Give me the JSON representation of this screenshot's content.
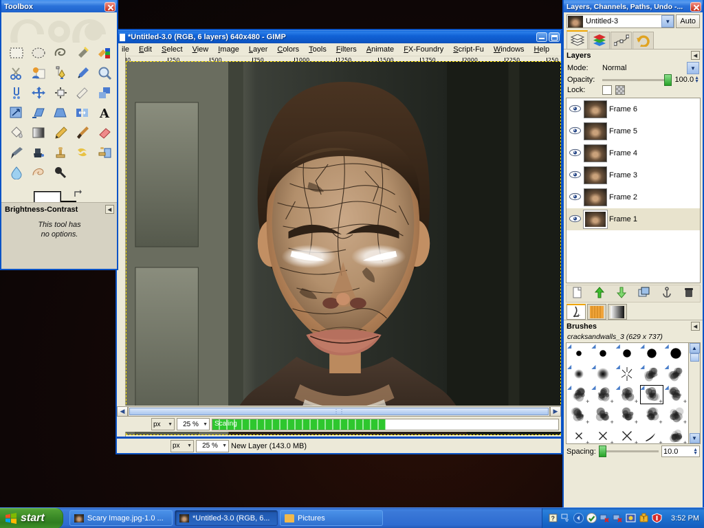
{
  "toolbox": {
    "title": "Toolbox",
    "tools": [
      {
        "name": "rect-select-tool",
        "label": "Rectangle Select"
      },
      {
        "name": "ellipse-select-tool",
        "label": "Ellipse Select"
      },
      {
        "name": "free-select-tool",
        "label": "Free Select"
      },
      {
        "name": "fuzzy-select-tool",
        "label": "Fuzzy Select"
      },
      {
        "name": "select-by-color-tool",
        "label": "Select by Color"
      },
      {
        "name": "scissors-select-tool",
        "label": "Intelligent Scissors"
      },
      {
        "name": "foreground-select-tool",
        "label": "Foreground Select"
      },
      {
        "name": "paths-tool",
        "label": "Paths"
      },
      {
        "name": "color-picker-tool",
        "label": "Color Picker"
      },
      {
        "name": "zoom-tool",
        "label": "Zoom"
      },
      {
        "name": "measure-tool",
        "label": "Measure"
      },
      {
        "name": "move-tool",
        "label": "Move"
      },
      {
        "name": "align-tool",
        "label": "Alignment"
      },
      {
        "name": "crop-tool",
        "label": "Crop"
      },
      {
        "name": "rotate-tool",
        "label": "Rotate"
      },
      {
        "name": "scale-tool",
        "label": "Scale"
      },
      {
        "name": "shear-tool",
        "label": "Shear"
      },
      {
        "name": "perspective-tool",
        "label": "Perspective"
      },
      {
        "name": "flip-tool",
        "label": "Flip"
      },
      {
        "name": "text-tool",
        "label": "Text"
      },
      {
        "name": "bucket-fill-tool",
        "label": "Bucket Fill"
      },
      {
        "name": "blend-tool",
        "label": "Blend"
      },
      {
        "name": "pencil-tool",
        "label": "Pencil"
      },
      {
        "name": "paintbrush-tool",
        "label": "Paintbrush"
      },
      {
        "name": "eraser-tool",
        "label": "Eraser"
      },
      {
        "name": "airbrush-tool",
        "label": "Airbrush"
      },
      {
        "name": "ink-tool",
        "label": "Ink"
      },
      {
        "name": "clone-tool",
        "label": "Clone"
      },
      {
        "name": "heal-tool",
        "label": "Heal"
      },
      {
        "name": "perspective-clone-tool",
        "label": "Perspective Clone"
      },
      {
        "name": "blur-sharpen-tool",
        "label": "Blur / Sharpen"
      },
      {
        "name": "smudge-tool",
        "label": "Smudge"
      },
      {
        "name": "dodge-burn-tool",
        "label": "Dodge / Burn"
      }
    ],
    "colors": {
      "foreground": "#ffffff",
      "background": "#000000"
    },
    "options": {
      "title": "Brightness-Contrast",
      "body_line1": "This tool has",
      "body_line2": "no options."
    }
  },
  "image_window": {
    "title": "*Untitled-3.0 (RGB, 6 layers) 640x480 - GIMP",
    "menu": [
      "ile",
      "Edit",
      "Select",
      "View",
      "Image",
      "Layer",
      "Colors",
      "Tools",
      "Filters",
      "Animate",
      "FX-Foundry",
      "Script-Fu",
      "Windows",
      "Help"
    ],
    "ruler_labels": [
      "0",
      "250",
      "500",
      "750",
      "1000",
      "1250",
      "1500",
      "1750",
      "2000",
      "2250",
      "250"
    ],
    "statusbar": {
      "unit": "px",
      "zoom": "25 %",
      "progress_label": "Scaling",
      "progress_percent": 50
    },
    "statusbar2": {
      "unit": "px",
      "zoom": "25 %",
      "message": "New Layer (143.0 MB)"
    },
    "buttons": {
      "minimize": "minimize",
      "maximize": "maximize"
    }
  },
  "dock": {
    "title": "Layers, Channels, Paths, Undo -...",
    "image_selector": {
      "value": "Untitled-3",
      "auto_label": "Auto"
    },
    "tabs": [
      {
        "name": "tab-layers",
        "label": "Layers",
        "active": true
      },
      {
        "name": "tab-channels",
        "label": "Channels",
        "active": false
      },
      {
        "name": "tab-paths",
        "label": "Paths",
        "active": false
      },
      {
        "name": "tab-undo",
        "label": "Undo History",
        "active": false
      }
    ],
    "layers_panel": {
      "title": "Layers",
      "mode_label": "Mode:",
      "mode_value": "Normal",
      "opacity_label": "Opacity:",
      "opacity_value": "100.0",
      "lock_label": "Lock:",
      "layers": [
        {
          "name": "Frame 6",
          "visible": true,
          "selected": false
        },
        {
          "name": "Frame 5",
          "visible": true,
          "selected": false
        },
        {
          "name": "Frame 4",
          "visible": true,
          "selected": false
        },
        {
          "name": "Frame 3",
          "visible": true,
          "selected": false
        },
        {
          "name": "Frame 2",
          "visible": true,
          "selected": false
        },
        {
          "name": "Frame 1",
          "visible": true,
          "selected": true
        }
      ],
      "buttons": [
        "new-layer",
        "raise-layer",
        "lower-layer",
        "duplicate-layer",
        "anchor-layer",
        "delete-layer"
      ]
    },
    "brushes_panel": {
      "tabs": [
        {
          "name": "tab-brushes",
          "active": true
        },
        {
          "name": "tab-patterns",
          "active": false
        },
        {
          "name": "tab-gradients",
          "active": false
        }
      ],
      "title": "Brushes",
      "selected_brush": "cracksandwalls_3 (629 x 737)",
      "spacing_label": "Spacing:",
      "spacing_value": "10.0",
      "selected_index": 13
    }
  },
  "taskbar": {
    "start_label": "start",
    "tasks": [
      {
        "label": "Scary Image.jpg-1.0 ...",
        "icon": "image-icon",
        "active": false
      },
      {
        "label": "*Untitled-3.0 (RGB, 6...",
        "icon": "image-icon",
        "active": true
      },
      {
        "label": "Pictures",
        "icon": "folder-icon",
        "active": false
      }
    ],
    "tray": {
      "icons": [
        "show-desktop-icon",
        "help-icon",
        "sound-icon",
        "network-icon",
        "network2-icon",
        "update-icon",
        "warning-icon",
        "security-icon"
      ],
      "clock": "3:52 PM"
    }
  },
  "colors": {
    "xp_blue": "#0a53c6",
    "face_accent": "#c79a74",
    "progress_green": "#2ec72e",
    "tab_highlight": "#f0a500"
  }
}
